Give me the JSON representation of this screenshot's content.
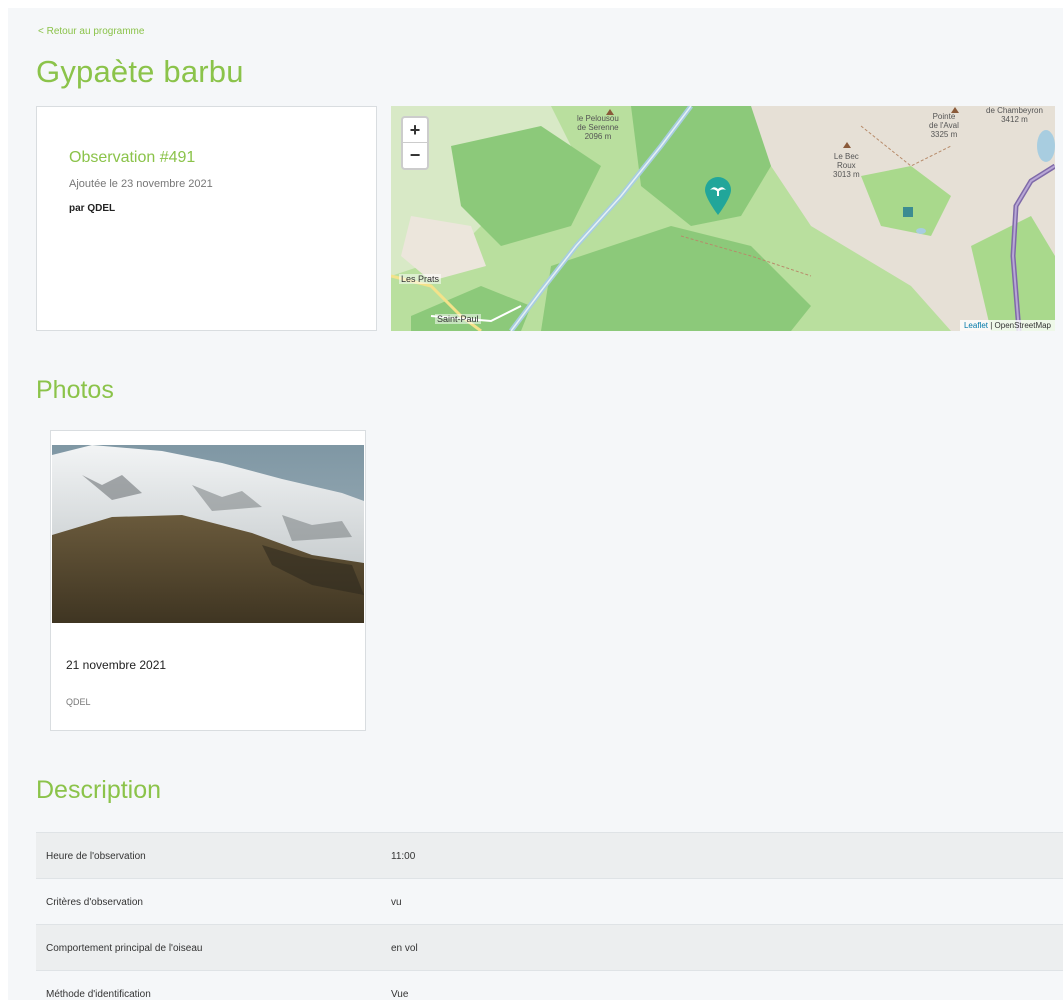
{
  "nav": {
    "back_label": "< Retour au programme"
  },
  "species": {
    "title": "Gypaète barbu"
  },
  "observation": {
    "title": "Observation #491",
    "added": "Ajoutée le 23 novembre 2021",
    "author": "par QDEL"
  },
  "map": {
    "zoom_in": "+",
    "zoom_out": "−",
    "peaks": [
      {
        "name": "le Pelousou\nde Serenne\n2096 m"
      },
      {
        "name": "Pointe\nde l'Aval\n3325 m"
      },
      {
        "name": "de Chambeyron\n3412 m"
      },
      {
        "name": "Le Bec\nRoux\n3013 m"
      }
    ],
    "towns": [
      "Les Prats",
      "Saint-Paul"
    ],
    "attribution_leaflet": "Leaflet",
    "attribution_osm": " | OpenStreetMap",
    "marker_icon": "bird-marker-icon",
    "colors": {
      "forest": "#8cc97a",
      "meadow": "#b9df9e",
      "rock": "#e6e0d6",
      "river": "#a8cde0",
      "road": "#7f6aa8",
      "marker": "#21a69a"
    }
  },
  "photos": {
    "section_title": "Photos",
    "items": [
      {
        "date": "21 novembre 2021",
        "author": "QDEL"
      }
    ]
  },
  "description": {
    "section_title": "Description",
    "rows": [
      {
        "key": "Heure de l'observation",
        "value": "11:00"
      },
      {
        "key": "Critères d'observation",
        "value": "vu"
      },
      {
        "key": "Comportement principal de l'oiseau",
        "value": "en vol"
      },
      {
        "key": "Méthode d'identification",
        "value": "Vue"
      }
    ]
  }
}
